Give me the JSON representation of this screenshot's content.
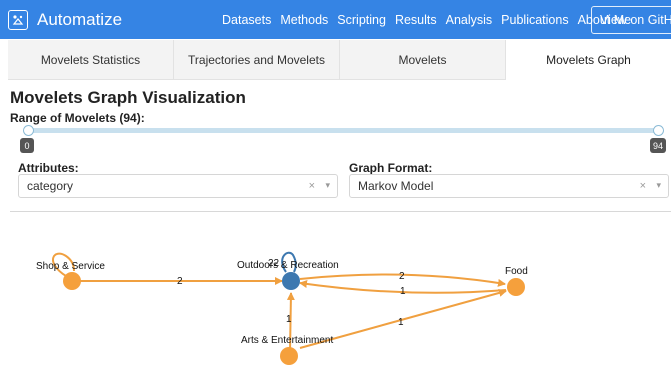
{
  "navbar": {
    "brand": "Automatize",
    "links": [
      "Datasets",
      "Methods",
      "Scripting",
      "Results",
      "Analysis",
      "Publications",
      "About Me"
    ],
    "github_label": "View on GitHub"
  },
  "tabs": [
    {
      "label": "Movelets Statistics",
      "active": false
    },
    {
      "label": "Trajectories and Movelets",
      "active": false
    },
    {
      "label": "Movelets",
      "active": false
    },
    {
      "label": "Movelets Graph",
      "active": true
    }
  ],
  "page_title": "Movelets Graph Visualization",
  "range": {
    "label": "Range of Movelets (94):",
    "min": "0",
    "max": "94",
    "selected_low": 0,
    "selected_high": 94
  },
  "attributes": {
    "label": "Attributes:",
    "value": "category"
  },
  "graph_format": {
    "label": "Graph Format:",
    "value": "Markov Model"
  },
  "select_controls": {
    "clear": "×",
    "arrow": "▾"
  },
  "graph": {
    "colors": {
      "edge": "#f0a040",
      "node_default": "#f5a03c",
      "node_highlight": "#3d78b0",
      "self_loop_highlight": "#3d78b0"
    },
    "nodes": [
      {
        "name": "Shop & Service"
      },
      {
        "name": "Outdoors & Recreation"
      },
      {
        "name": "Food"
      },
      {
        "name": "Arts & Entertainment"
      }
    ],
    "edge_labels": {
      "shop_to_outdoors": "2",
      "outdoors_self": "22",
      "outdoors_to_food": "2",
      "food_to_outdoors": "1",
      "arts_to_outdoors": "1",
      "arts_to_food": "1"
    }
  }
}
